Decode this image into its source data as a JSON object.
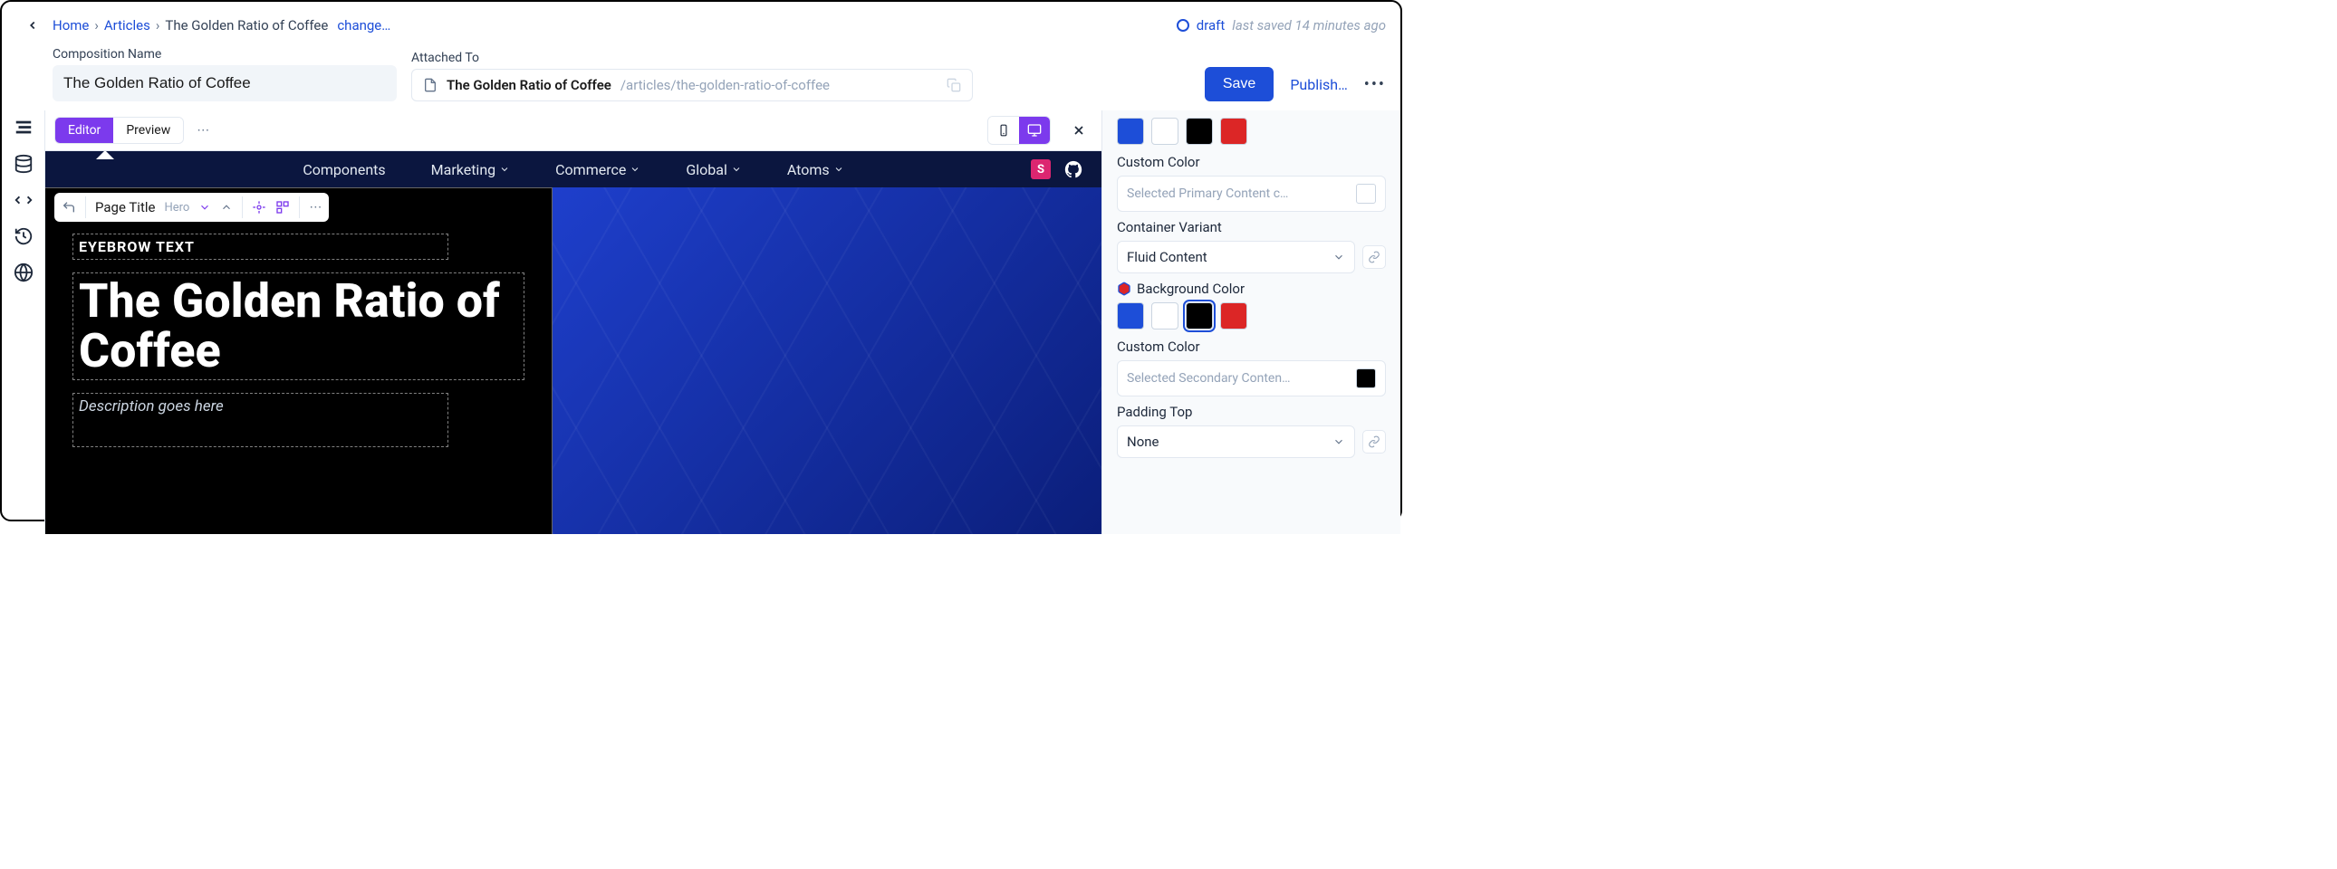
{
  "breadcrumb": {
    "home": "Home",
    "articles": "Articles",
    "current": "The Golden Ratio of Coffee",
    "change": "change…"
  },
  "status": {
    "label": "draft",
    "saved": "last saved 14 minutes ago"
  },
  "fields": {
    "comp_label": "Composition Name",
    "comp_value": "The Golden Ratio of Coffee",
    "attached_label": "Attached To",
    "attached_title": "The Golden Ratio of Coffee",
    "attached_path": "/articles/the-golden-ratio-of-coffee"
  },
  "actions": {
    "save": "Save",
    "publish": "Publish…"
  },
  "toolbar": {
    "editor": "Editor",
    "preview": "Preview"
  },
  "site_nav": {
    "components": "Components",
    "marketing": "Marketing",
    "commerce": "Commerce",
    "global": "Global",
    "atoms": "Atoms"
  },
  "floating": {
    "title": "Page Title",
    "context": "Hero"
  },
  "hero": {
    "eyebrow": "EYEBROW TEXT",
    "title": "The Golden Ratio of Coffee",
    "description": "Description goes here"
  },
  "panel": {
    "custom_color1_label": "Custom Color",
    "custom_color1_placeholder": "Selected Primary Content c…",
    "container_variant_label": "Container Variant",
    "container_variant_value": "Fluid Content",
    "bg_color_label": "Background Color",
    "custom_color2_label": "Custom Color",
    "custom_color2_placeholder": "Selected Secondary Conten…",
    "padding_top_label": "Padding Top",
    "padding_top_value": "None",
    "swatches_top": [
      "#1d4ed8",
      "#ffffff",
      "#000000",
      "#dc2626"
    ],
    "swatches_bg": [
      "#1d4ed8",
      "#ffffff",
      "#000000",
      "#dc2626"
    ],
    "swatches_bg_selected_index": 2,
    "custom_color2_swatch": "#000000"
  },
  "icons": {
    "chevron_down": "chevron-down-icon"
  }
}
